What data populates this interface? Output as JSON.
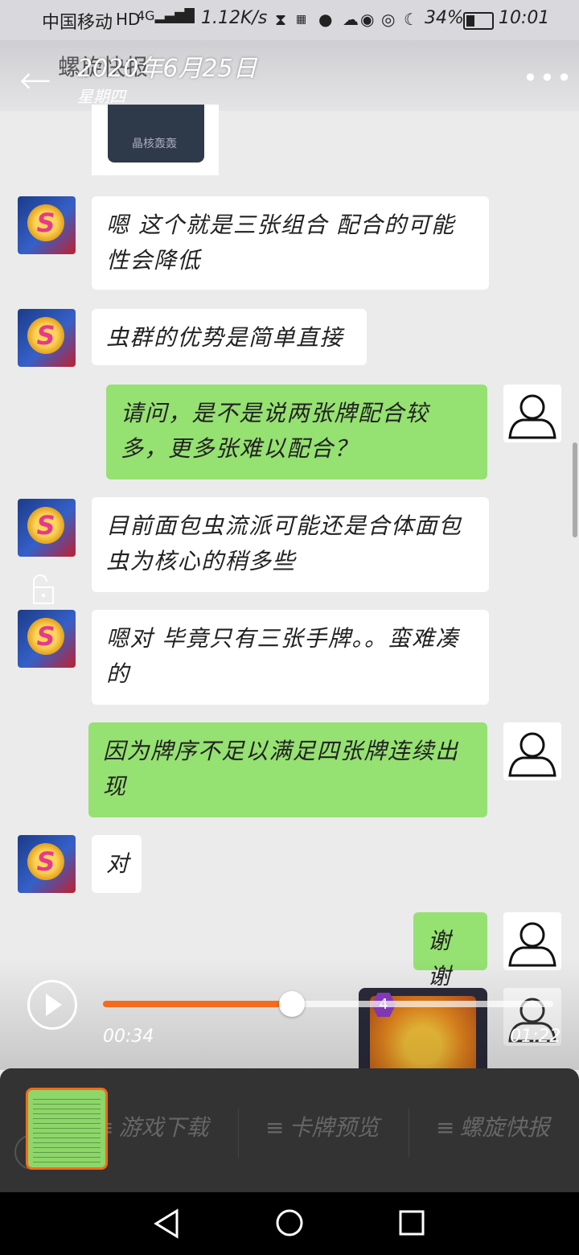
{
  "status_bar": {
    "carrier": "中国移动",
    "net_speed": "1.12K/s",
    "battery": "34%",
    "battery_level": 0.34,
    "time": "10:01"
  },
  "header": {
    "contact_name": "螺旋快报",
    "date": "2020年6月25日",
    "weekday": "星期四"
  },
  "thumbnail": {
    "caption": "晶核轰轰"
  },
  "messages": [
    {
      "side": "left",
      "text": "嗯 这个就是三张组合 配合的可能性会降低"
    },
    {
      "side": "left",
      "text": "虫群的优势是简单直接"
    },
    {
      "side": "right",
      "text": "请问，是不是说两张牌配合较多，更多张难以配合？"
    },
    {
      "side": "left",
      "text": "目前面包虫流派可能还是合体面包虫为核心的稍多些"
    },
    {
      "side": "left",
      "text": "嗯对 毕竟只有三张手牌。。蛮难凑的"
    },
    {
      "side": "right",
      "text": "因为牌序不足以满足四张牌连续出现"
    },
    {
      "side": "left",
      "text": "对"
    },
    {
      "side": "right",
      "text": "谢谢"
    }
  ],
  "video": {
    "current_time": "00:34",
    "total_time": "01:22",
    "progress": 0.42,
    "card_cost": "4",
    "card_marks": [
      "X",
      "X"
    ]
  },
  "bottom_tabs": [
    {
      "label": "游戏下载"
    },
    {
      "label": "卡牌预览"
    },
    {
      "label": "螺旋快报"
    }
  ],
  "colors": {
    "accent": "#f56a1b",
    "bubble_green": "#95e172"
  }
}
